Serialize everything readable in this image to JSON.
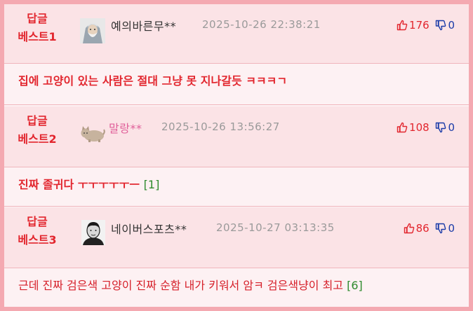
{
  "comments": [
    {
      "rank_line1": "답글",
      "rank_line2": "베스트1",
      "avatar": "old-man-avatar-icon",
      "nickname": "예의바른무**",
      "date": "2025-10-26 22:38:21",
      "upvotes": "176",
      "downvotes": "0",
      "text": "집에 고양이 있는 사람은 절대 그냥 못 지나갈듯 ㅋㅋㅋㄱ",
      "replies": ""
    },
    {
      "rank_line1": "답글",
      "rank_line2": "베스트2",
      "avatar": "cat-avatar-icon",
      "nickname": "말랑**",
      "date": "2025-10-26 13:56:27",
      "upvotes": "108",
      "downvotes": "0",
      "text": "진짜 졸귀다 ㅜㅜㅜㅜㅜㅡ",
      "replies": "[1]"
    },
    {
      "rank_line1": "답글",
      "rank_line2": "베스트3",
      "avatar": "man-portrait-avatar-icon",
      "nickname": "네이버스포츠**",
      "date": "2025-10-27 03:13:35",
      "upvotes": "86",
      "downvotes": "0",
      "text": "근데 진짜 검은색 고양이 진짜 순함 내가 키워서 암ㅋ 검은색냥이 최고",
      "replies": "[6]"
    }
  ],
  "colors": {
    "best_red": "#e2262e",
    "downvote_blue": "#1a3ba8",
    "reply_green": "#2e8b2e",
    "header_bg": "#fbe3e6",
    "border_pink": "#f4a9b1"
  }
}
